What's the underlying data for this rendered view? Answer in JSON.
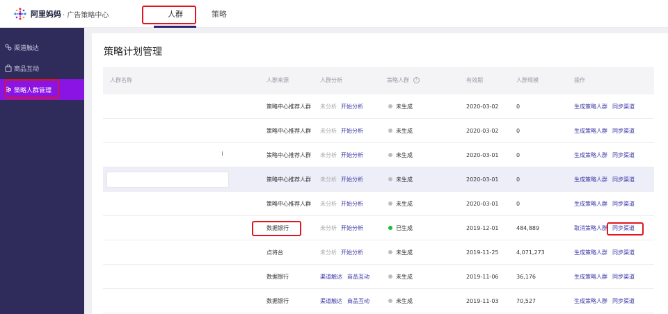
{
  "header": {
    "logo_text": "阿里妈妈",
    "logo_sub": "· 广告策略中心",
    "tabs": [
      {
        "label": "人群",
        "active": true
      },
      {
        "label": "策略",
        "active": false
      }
    ]
  },
  "sidebar": {
    "items": [
      {
        "label": "渠道触达",
        "icon": "link-icon"
      },
      {
        "label": "商品互动",
        "icon": "bag-icon"
      },
      {
        "label": "策略人群管理",
        "icon": "users-icon",
        "active": true
      }
    ]
  },
  "main": {
    "title": "策略计划管理",
    "columns": [
      "人群名称",
      "人群来源",
      "人群分析",
      "策略人群",
      "有效期",
      "人群规模",
      "操作"
    ],
    "rows": [
      {
        "source": "策略中心推荐人群",
        "analysis_status": "未分析",
        "analysis_action": "开始分析",
        "strategy": "未生成",
        "date": "2020-03-02",
        "scale": "0",
        "op1": "生成策略人群",
        "op2": "同步渠道"
      },
      {
        "source": "策略中心推荐人群",
        "analysis_status": "未分析",
        "analysis_action": "开始分析",
        "strategy": "未生成",
        "date": "2020-03-02",
        "scale": "0",
        "op1": "生成策略人群",
        "op2": "同步渠道"
      },
      {
        "source": "策略中心推荐人群",
        "analysis_status": "未分析",
        "analysis_action": "开始分析",
        "strategy": "未生成",
        "date": "2020-03-01",
        "scale": "0",
        "op1": "生成策略人群",
        "op2": "同步渠道"
      },
      {
        "source": "策略中心推荐人群",
        "analysis_status": "未分析",
        "analysis_action": "开始分析",
        "strategy": "未生成",
        "date": "2020-03-01",
        "scale": "0",
        "op1": "生成策略人群",
        "op2": "同步渠道"
      },
      {
        "source": "策略中心推荐人群",
        "analysis_status": "未分析",
        "analysis_action": "开始分析",
        "strategy": "未生成",
        "date": "2020-03-01",
        "scale": "0",
        "op1": "生成策略人群",
        "op2": "同步渠道"
      },
      {
        "source": "数据银行",
        "analysis_status": "未分析",
        "analysis_action": "开始分析",
        "strategy": "已生成",
        "date": "2019-12-01",
        "scale": "484,889",
        "op1": "取消策略人群",
        "op2": "同步渠道"
      },
      {
        "source": "点将台",
        "analysis_status": "未分析",
        "analysis_action": "开始分析",
        "strategy": "未生成",
        "date": "2019-11-25",
        "scale": "4,071,273",
        "op1": "生成策略人群",
        "op2": "同步渠道"
      },
      {
        "source": "数据银行",
        "analysis_status": "渠道触达",
        "analysis_action": "商品互动",
        "strategy": "未生成",
        "date": "2019-11-06",
        "scale": "36,176",
        "op1": "生成策略人群",
        "op2": "同步渠道"
      },
      {
        "source": "数据银行",
        "analysis_status": "渠道触达",
        "analysis_action": "商品互动",
        "strategy": "未生成",
        "date": "2019-11-03",
        "scale": "70,527",
        "op1": "生成策略人群",
        "op2": "同步渠道"
      }
    ]
  },
  "colors": {
    "sidebar_bg": "#2f2c5b",
    "sidebar_active": "#8a14e3",
    "link": "#3c37a6",
    "highlight": "#e0161e",
    "status_on": "#1fba3b",
    "status_off": "#bdbdbd"
  }
}
